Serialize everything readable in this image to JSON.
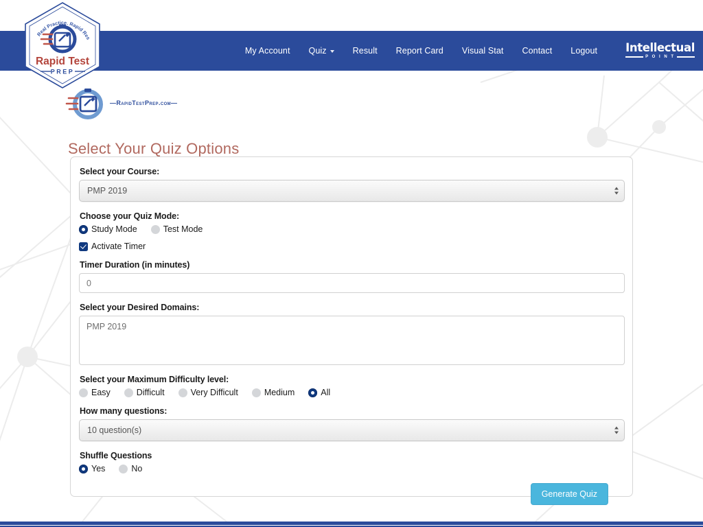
{
  "brand": {
    "hex_logo": {
      "tagline": "Real Practice. Rapid Results.",
      "name_line1": "Rapid Test",
      "name_line2": "PREP"
    },
    "sub_logo_text": "—RapidTestPrep.com—",
    "partner": {
      "name": "Intellectual",
      "sub": "P O I N T"
    }
  },
  "nav": {
    "items": [
      {
        "label": "My Account",
        "has_caret": false
      },
      {
        "label": "Quiz",
        "has_caret": true
      },
      {
        "label": "Result",
        "has_caret": false
      },
      {
        "label": "Report Card",
        "has_caret": false
      },
      {
        "label": "Visual Stat",
        "has_caret": false
      },
      {
        "label": "Contact",
        "has_caret": false
      },
      {
        "label": "Logout",
        "has_caret": false
      }
    ]
  },
  "page": {
    "title": "Select Your Quiz Options"
  },
  "form": {
    "course": {
      "label": "Select your Course:",
      "value": "PMP 2019"
    },
    "quiz_mode": {
      "label": "Choose your Quiz Mode:",
      "options": [
        {
          "label": "Study Mode",
          "selected": true
        },
        {
          "label": "Test Mode",
          "selected": false
        }
      ]
    },
    "activate_timer": {
      "label": "Activate Timer",
      "checked": true
    },
    "timer_duration": {
      "label": "Timer Duration (in minutes)",
      "value": "0"
    },
    "domains": {
      "label": "Select your Desired Domains:",
      "options": [
        {
          "label": "PMP 2019",
          "selected": false
        }
      ]
    },
    "difficulty": {
      "label": "Select your Maximum Difficulty level:",
      "options": [
        {
          "label": "Easy",
          "selected": false
        },
        {
          "label": "Difficult",
          "selected": false
        },
        {
          "label": "Very Difficult",
          "selected": false
        },
        {
          "label": "Medium",
          "selected": false
        },
        {
          "label": "All",
          "selected": true
        }
      ]
    },
    "question_count": {
      "label": "How many questions:",
      "value": "10 question(s)"
    },
    "shuffle": {
      "label": "Shuffle Questions",
      "options": [
        {
          "label": "Yes",
          "selected": true
        },
        {
          "label": "No",
          "selected": false
        }
      ]
    },
    "submit": {
      "label": "Generate Quiz"
    }
  },
  "colors": {
    "navbar": "#2b4b9b",
    "title": "#b1695f",
    "accent_button": "#4ab6dd",
    "radio_selected": "#10397f",
    "logo_red": "#b3443b"
  }
}
